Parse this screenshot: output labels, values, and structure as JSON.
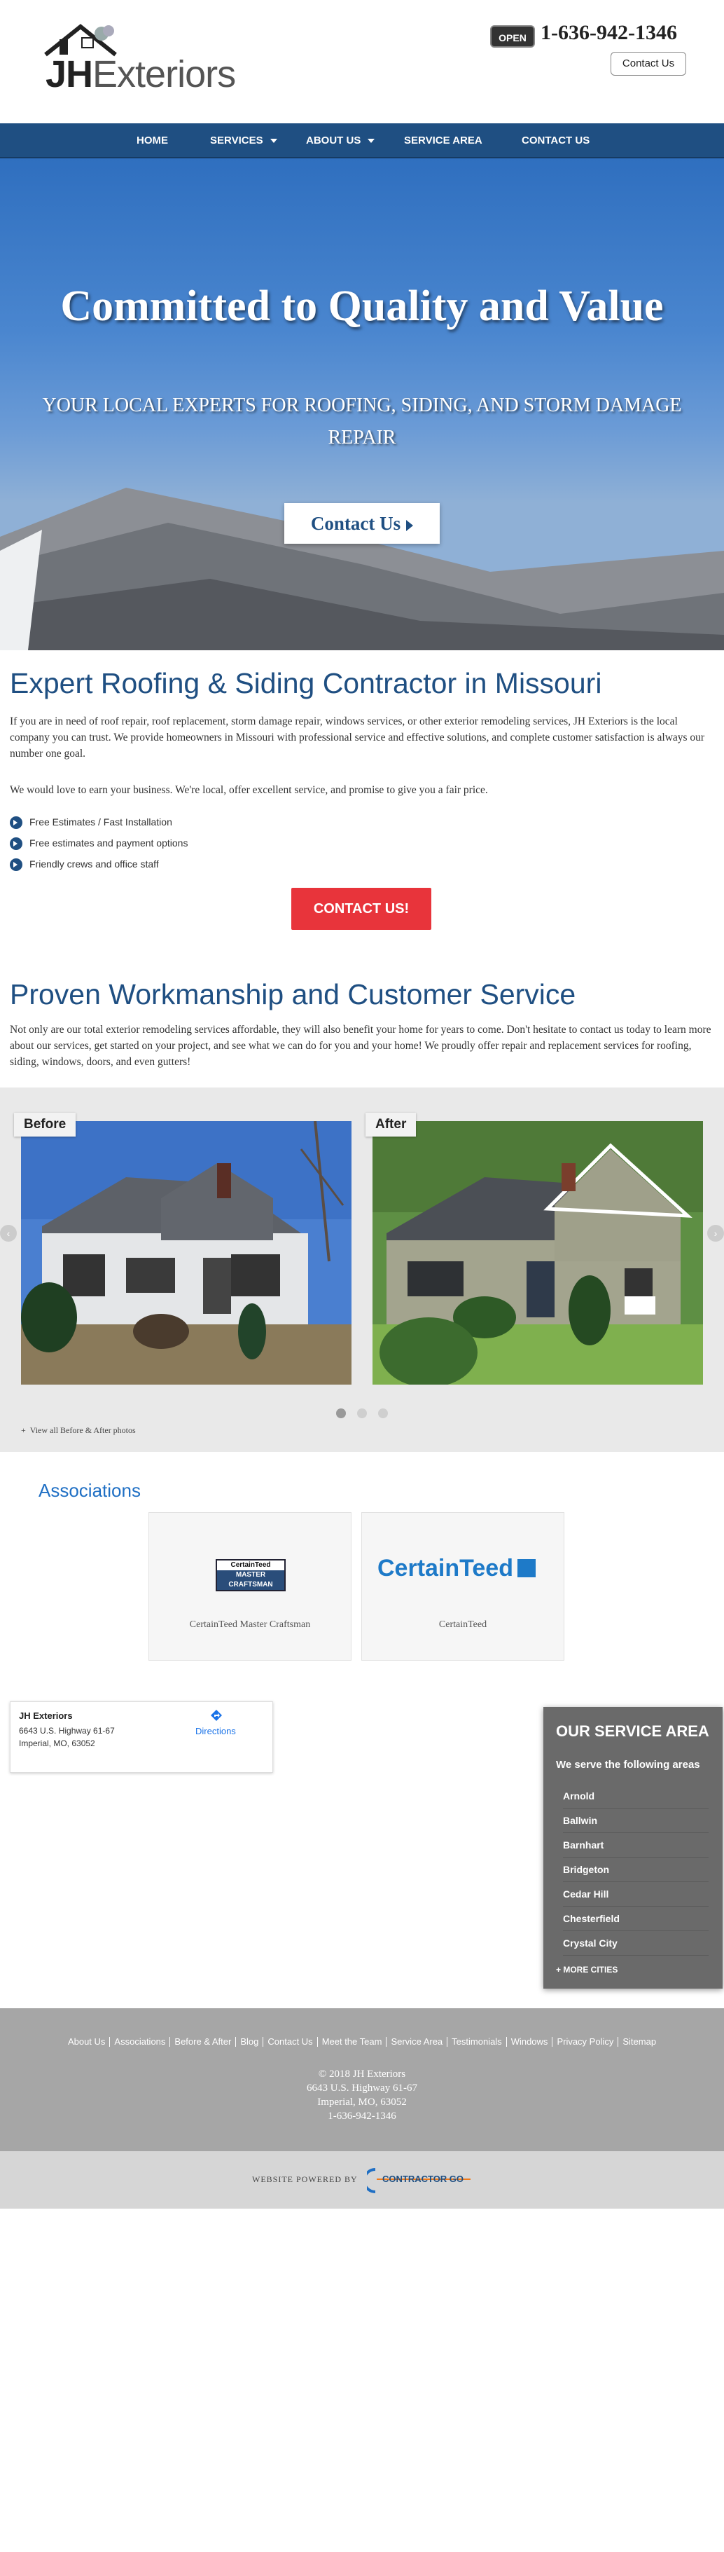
{
  "header": {
    "logo_text_bold": "JH",
    "logo_text_rest": "Exteriors",
    "open_badge": "OPEN",
    "phone": "1-636-942-1346",
    "contact_button": "Contact Us"
  },
  "nav": {
    "items": [
      {
        "label": "HOME"
      },
      {
        "label": "SERVICES"
      },
      {
        "label": "ABOUT US"
      },
      {
        "label": "SERVICE AREA"
      },
      {
        "label": "CONTACT US"
      }
    ]
  },
  "hero": {
    "title": "Committed to Quality and Value",
    "subtitle": "YOUR LOCAL EXPERTS FOR ROOFING, SIDING, AND STORM DAMAGE REPAIR",
    "cta": "Contact Us"
  },
  "intro": {
    "heading": "Expert Roofing & Siding Contractor in Missouri",
    "p1": "If you are in need of roof repair, roof replacement, storm damage repair, windows services, or other exterior remodeling services, JH Exteriors is the local company you can trust. We provide homeowners in Missouri with professional service and effective solutions, and complete customer satisfaction is always our number one goal.",
    "p2": "We would love to earn your business. We're local, offer excellent service, and promise to give you a fair price.",
    "checks": [
      "Free Estimates / Fast Installation",
      "Free estimates and payment options",
      "Friendly crews and office staff"
    ],
    "cta": "CONTACT US!"
  },
  "workmanship": {
    "heading": "Proven Workmanship and Customer Service",
    "p": "Not only are our total exterior remodeling services affordable, they will also benefit your home for years to come. Don't hesitate to contact us today to learn more about our services, get started on your project, and see what we can do for you and your home! We proudly offer repair and replacement services for roofing, siding, windows, doors, and even gutters!"
  },
  "gallery": {
    "before_label": "Before",
    "after_label": "After",
    "view_all": "View all Before & After photos",
    "slide_count": 3,
    "active_slide": 1
  },
  "associations": {
    "title": "Associations",
    "cards": [
      {
        "logo_lines": [
          "CertainTeed",
          "MASTER",
          "CRAFTSMAN"
        ],
        "caption": "CertainTeed Master Craftsman"
      },
      {
        "logo_text": "CertainTeed",
        "caption": "CertainTeed"
      }
    ]
  },
  "map": {
    "name": "JH Exteriors",
    "address1": "6643 U.S. Highway 61-67",
    "address2": "Imperial, MO, 63052",
    "directions": "Directions"
  },
  "service_area": {
    "title": "OUR SERVICE AREA",
    "subtitle": "We serve the following areas",
    "cities": [
      "Arnold",
      "Ballwin",
      "Barnhart",
      "Bridgeton",
      "Cedar Hill",
      "Chesterfield",
      "Crystal City"
    ],
    "more": "+ MORE CITIES"
  },
  "footer": {
    "links": [
      "About Us",
      "Associations",
      "Before & After",
      "Blog",
      "Contact Us",
      "Meet the Team",
      "Service Area",
      "Testimonials",
      "Windows",
      "Privacy Policy",
      "Sitemap"
    ],
    "copyright": "© 2018 JH Exteriors",
    "address1": "6643 U.S. Highway 61-67",
    "address2": "Imperial, MO, 63052",
    "phone": "1-636-942-1346",
    "powered_by": "WEBSITE POWERED BY",
    "powered_logo": "CONTRACTOR GO"
  },
  "colors": {
    "nav_blue": "#1f4f82",
    "cta_red": "#e8343b",
    "heading_blue": "#1f4f82",
    "service_panel": "#6a6a6a",
    "footer_gray": "#a6a6a6"
  }
}
